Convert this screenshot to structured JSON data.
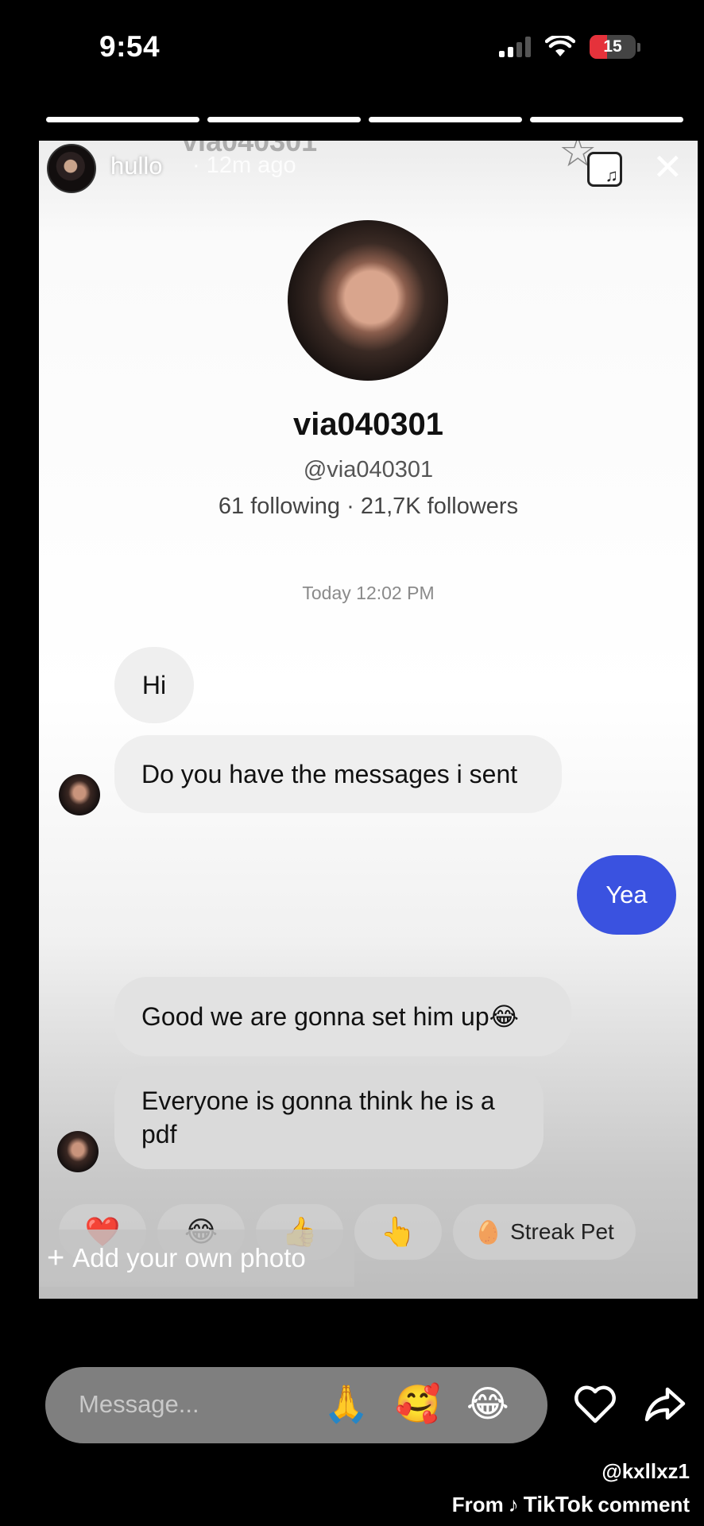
{
  "status_bar": {
    "time": "9:54",
    "battery": "15",
    "battery_level": 0.15,
    "signal_bars": 2,
    "signal_total": 4
  },
  "story": {
    "progress_segments": 4,
    "username": "hullo",
    "time_ago": "· 12m ago",
    "background_ghost_text": "via040301",
    "icons": {
      "music": "music-sticker-icon",
      "close": "close-icon"
    }
  },
  "chat": {
    "profile_name": "via040301",
    "profile_handle": "@via040301",
    "profile_stats": "61 following · 21,7K followers",
    "date_label": "Today 12:02 PM",
    "messages": [
      {
        "text": "Hi",
        "side": "left"
      },
      {
        "text": "Do you have the messages i sent",
        "side": "left"
      },
      {
        "text": "Yea",
        "side": "right"
      },
      {
        "text": "Good we are gonna set him up😂",
        "side": "left"
      },
      {
        "text": "Everyone is gonna think he is a pdf",
        "side": "left"
      }
    ],
    "reactions": [
      "❤️",
      "😂",
      "👍",
      "👆"
    ],
    "streak_pet": "Streak Pet"
  },
  "add_photo": {
    "label": "Add your own photo",
    "plus": "+"
  },
  "message_bar": {
    "placeholder": "Message...",
    "emojis": [
      "🙏",
      "🥰",
      "😂"
    ]
  },
  "watermark": {
    "user": "@kxllxz1",
    "from": "From",
    "brand": "TikTok",
    "suffix": "comment"
  },
  "colors": {
    "sent_bubble": "#3a52e0",
    "battery_low": "#e5323b"
  }
}
